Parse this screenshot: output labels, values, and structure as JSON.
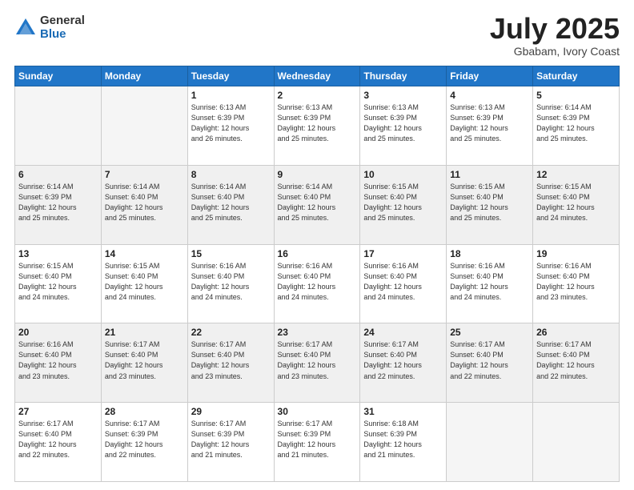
{
  "logo": {
    "general": "General",
    "blue": "Blue"
  },
  "title": "July 2025",
  "location": "Gbabam, Ivory Coast",
  "days_of_week": [
    "Sunday",
    "Monday",
    "Tuesday",
    "Wednesday",
    "Thursday",
    "Friday",
    "Saturday"
  ],
  "weeks": [
    [
      {
        "num": "",
        "empty": true
      },
      {
        "num": "",
        "empty": true
      },
      {
        "num": "1",
        "sunrise": "6:13 AM",
        "sunset": "6:39 PM",
        "daylight": "12 hours and 26 minutes."
      },
      {
        "num": "2",
        "sunrise": "6:13 AM",
        "sunset": "6:39 PM",
        "daylight": "12 hours and 25 minutes."
      },
      {
        "num": "3",
        "sunrise": "6:13 AM",
        "sunset": "6:39 PM",
        "daylight": "12 hours and 25 minutes."
      },
      {
        "num": "4",
        "sunrise": "6:13 AM",
        "sunset": "6:39 PM",
        "daylight": "12 hours and 25 minutes."
      },
      {
        "num": "5",
        "sunrise": "6:14 AM",
        "sunset": "6:39 PM",
        "daylight": "12 hours and 25 minutes."
      }
    ],
    [
      {
        "num": "6",
        "sunrise": "6:14 AM",
        "sunset": "6:39 PM",
        "daylight": "12 hours and 25 minutes."
      },
      {
        "num": "7",
        "sunrise": "6:14 AM",
        "sunset": "6:40 PM",
        "daylight": "12 hours and 25 minutes."
      },
      {
        "num": "8",
        "sunrise": "6:14 AM",
        "sunset": "6:40 PM",
        "daylight": "12 hours and 25 minutes."
      },
      {
        "num": "9",
        "sunrise": "6:14 AM",
        "sunset": "6:40 PM",
        "daylight": "12 hours and 25 minutes."
      },
      {
        "num": "10",
        "sunrise": "6:15 AM",
        "sunset": "6:40 PM",
        "daylight": "12 hours and 25 minutes."
      },
      {
        "num": "11",
        "sunrise": "6:15 AM",
        "sunset": "6:40 PM",
        "daylight": "12 hours and 25 minutes."
      },
      {
        "num": "12",
        "sunrise": "6:15 AM",
        "sunset": "6:40 PM",
        "daylight": "12 hours and 24 minutes."
      }
    ],
    [
      {
        "num": "13",
        "sunrise": "6:15 AM",
        "sunset": "6:40 PM",
        "daylight": "12 hours and 24 minutes."
      },
      {
        "num": "14",
        "sunrise": "6:15 AM",
        "sunset": "6:40 PM",
        "daylight": "12 hours and 24 minutes."
      },
      {
        "num": "15",
        "sunrise": "6:16 AM",
        "sunset": "6:40 PM",
        "daylight": "12 hours and 24 minutes."
      },
      {
        "num": "16",
        "sunrise": "6:16 AM",
        "sunset": "6:40 PM",
        "daylight": "12 hours and 24 minutes."
      },
      {
        "num": "17",
        "sunrise": "6:16 AM",
        "sunset": "6:40 PM",
        "daylight": "12 hours and 24 minutes."
      },
      {
        "num": "18",
        "sunrise": "6:16 AM",
        "sunset": "6:40 PM",
        "daylight": "12 hours and 24 minutes."
      },
      {
        "num": "19",
        "sunrise": "6:16 AM",
        "sunset": "6:40 PM",
        "daylight": "12 hours and 23 minutes."
      }
    ],
    [
      {
        "num": "20",
        "sunrise": "6:16 AM",
        "sunset": "6:40 PM",
        "daylight": "12 hours and 23 minutes."
      },
      {
        "num": "21",
        "sunrise": "6:17 AM",
        "sunset": "6:40 PM",
        "daylight": "12 hours and 23 minutes."
      },
      {
        "num": "22",
        "sunrise": "6:17 AM",
        "sunset": "6:40 PM",
        "daylight": "12 hours and 23 minutes."
      },
      {
        "num": "23",
        "sunrise": "6:17 AM",
        "sunset": "6:40 PM",
        "daylight": "12 hours and 23 minutes."
      },
      {
        "num": "24",
        "sunrise": "6:17 AM",
        "sunset": "6:40 PM",
        "daylight": "12 hours and 22 minutes."
      },
      {
        "num": "25",
        "sunrise": "6:17 AM",
        "sunset": "6:40 PM",
        "daylight": "12 hours and 22 minutes."
      },
      {
        "num": "26",
        "sunrise": "6:17 AM",
        "sunset": "6:40 PM",
        "daylight": "12 hours and 22 minutes."
      }
    ],
    [
      {
        "num": "27",
        "sunrise": "6:17 AM",
        "sunset": "6:40 PM",
        "daylight": "12 hours and 22 minutes."
      },
      {
        "num": "28",
        "sunrise": "6:17 AM",
        "sunset": "6:39 PM",
        "daylight": "12 hours and 22 minutes."
      },
      {
        "num": "29",
        "sunrise": "6:17 AM",
        "sunset": "6:39 PM",
        "daylight": "12 hours and 21 minutes."
      },
      {
        "num": "30",
        "sunrise": "6:17 AM",
        "sunset": "6:39 PM",
        "daylight": "12 hours and 21 minutes."
      },
      {
        "num": "31",
        "sunrise": "6:18 AM",
        "sunset": "6:39 PM",
        "daylight": "12 hours and 21 minutes."
      },
      {
        "num": "",
        "empty": true
      },
      {
        "num": "",
        "empty": true
      }
    ]
  ],
  "labels": {
    "sunrise": "Sunrise:",
    "sunset": "Sunset:",
    "daylight": "Daylight:"
  }
}
